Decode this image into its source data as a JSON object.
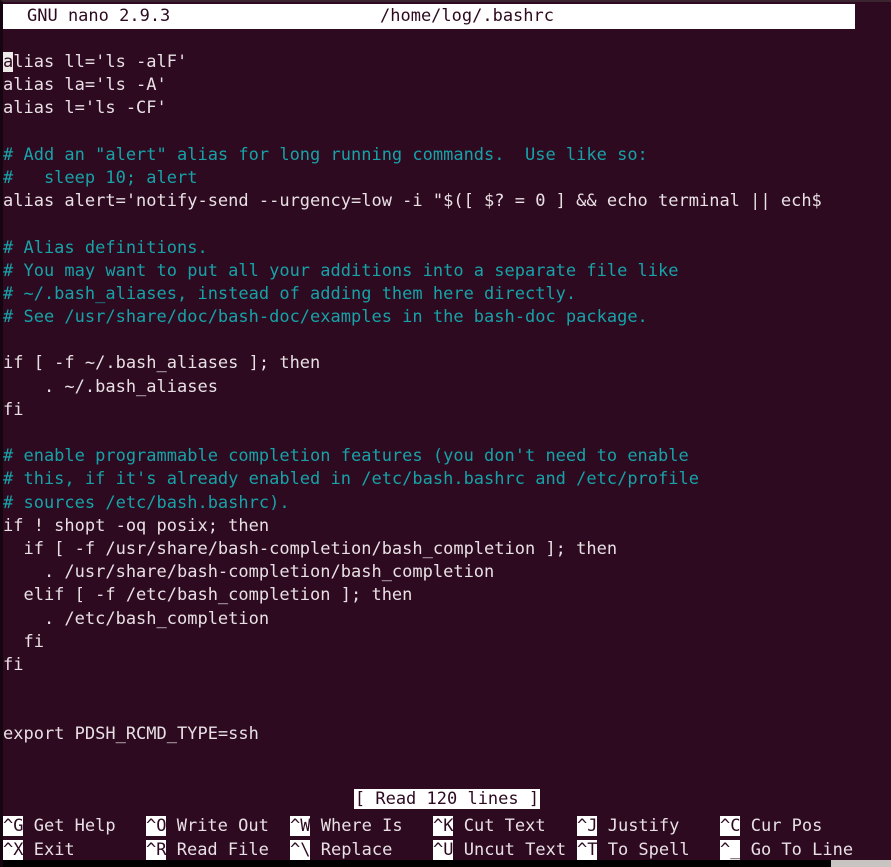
{
  "window": {
    "background_color": "#2d0a20",
    "text_color": "#e8e0e4",
    "comment_color": "#17a2a8",
    "inverse_bg_color": "#ffffff",
    "inverse_fg_color": "#2d0a20"
  },
  "title_bar": {
    "version": "GNU nano 2.9.3",
    "filename": "/home/log/.bashrc"
  },
  "editor": {
    "cursor": {
      "line": 1,
      "column": 1,
      "char": "a"
    },
    "lines": [
      {
        "text": "alias ll='ls -alF'",
        "comment": false,
        "cursor_at_start": true
      },
      {
        "text": "alias la='ls -A'",
        "comment": false
      },
      {
        "text": "alias l='ls -CF'",
        "comment": false
      },
      {
        "text": "",
        "comment": false
      },
      {
        "text": "# Add an \"alert\" alias for long running commands.  Use like so:",
        "comment": true
      },
      {
        "text": "#   sleep 10; alert",
        "comment": true
      },
      {
        "text": "alias alert='notify-send --urgency=low -i \"$([ $? = 0 ] && echo terminal || ech$",
        "comment": false
      },
      {
        "text": "",
        "comment": false
      },
      {
        "text": "# Alias definitions.",
        "comment": true
      },
      {
        "text": "# You may want to put all your additions into a separate file like",
        "comment": true
      },
      {
        "text": "# ~/.bash_aliases, instead of adding them here directly.",
        "comment": true
      },
      {
        "text": "# See /usr/share/doc/bash-doc/examples in the bash-doc package.",
        "comment": true
      },
      {
        "text": "",
        "comment": false
      },
      {
        "text": "if [ -f ~/.bash_aliases ]; then",
        "comment": false
      },
      {
        "text": "    . ~/.bash_aliases",
        "comment": false
      },
      {
        "text": "fi",
        "comment": false
      },
      {
        "text": "",
        "comment": false
      },
      {
        "text": "# enable programmable completion features (you don't need to enable",
        "comment": true
      },
      {
        "text": "# this, if it's already enabled in /etc/bash.bashrc and /etc/profile",
        "comment": true
      },
      {
        "text": "# sources /etc/bash.bashrc).",
        "comment": true
      },
      {
        "text": "if ! shopt -oq posix; then",
        "comment": false
      },
      {
        "text": "  if [ -f /usr/share/bash-completion/bash_completion ]; then",
        "comment": false
      },
      {
        "text": "    . /usr/share/bash-completion/bash_completion",
        "comment": false
      },
      {
        "text": "  elif [ -f /etc/bash_completion ]; then",
        "comment": false
      },
      {
        "text": "    . /etc/bash_completion",
        "comment": false
      },
      {
        "text": "  fi",
        "comment": false
      },
      {
        "text": "fi",
        "comment": false
      },
      {
        "text": "",
        "comment": false
      },
      {
        "text": "",
        "comment": false
      },
      {
        "text": "export PDSH_RCMD_TYPE=ssh",
        "comment": false
      }
    ]
  },
  "status_message": "[ Read 120 lines ]",
  "help_bar": {
    "row1": [
      {
        "key": "^G",
        "label": " Get Help"
      },
      {
        "key": "^O",
        "label": " Write Out"
      },
      {
        "key": "^W",
        "label": " Where Is"
      },
      {
        "key": "^K",
        "label": " Cut Text"
      },
      {
        "key": "^J",
        "label": " Justify"
      },
      {
        "key": "^C",
        "label": " Cur Pos"
      }
    ],
    "row2": [
      {
        "key": "^X",
        "label": " Exit"
      },
      {
        "key": "^R",
        "label": " Read File"
      },
      {
        "key": "^\\",
        "label": " Replace"
      },
      {
        "key": "^U",
        "label": " Uncut Text"
      },
      {
        "key": "^T",
        "label": " To Spell"
      },
      {
        "key": "^_",
        "label": " Go To Line"
      }
    ]
  }
}
